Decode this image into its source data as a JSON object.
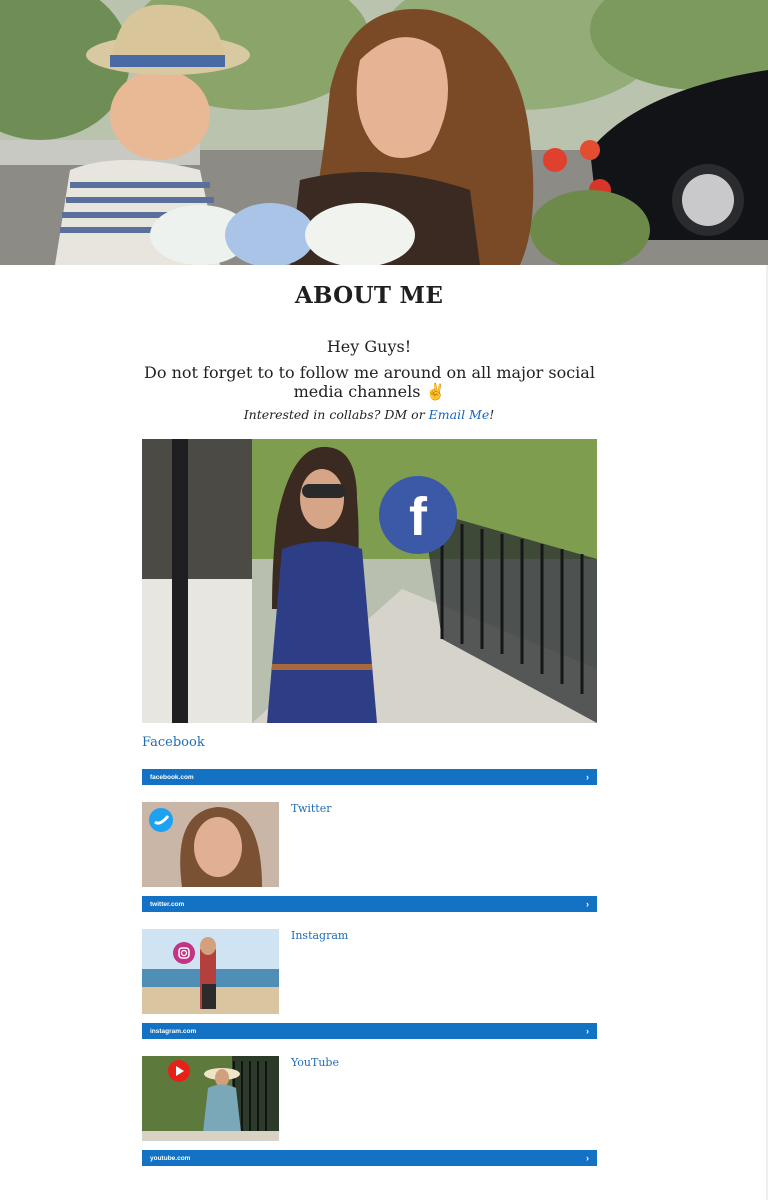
{
  "page": {
    "title": "ABOUT ME",
    "greeting": "Hey Guys!",
    "follow_text": "Do not forget to to follow me around on all major social media channels",
    "follow_emoji": "✌",
    "collab_prefix": "Interested in collabs? DM or ",
    "collab_link": "Email Me",
    "collab_suffix": "!"
  },
  "hero": {
    "icon": "hero-photo"
  },
  "facebook": {
    "label": "Facebook",
    "domain": "facebook.com",
    "icon": "facebook-icon",
    "color": "#3b5998"
  },
  "cards": [
    {
      "title": "Twitter",
      "domain": "twitter.com",
      "icon": "twitter-icon",
      "color": "#1da1f2"
    },
    {
      "title": "Instagram",
      "domain": "instagram.com",
      "icon": "instagram-icon",
      "color": "#c13584"
    },
    {
      "title": "YouTube",
      "domain": "youtube.com",
      "icon": "youtube-icon",
      "color": "#e62117"
    }
  ],
  "colors": {
    "link": "#1e6cb8",
    "bar": "#1472c4"
  }
}
